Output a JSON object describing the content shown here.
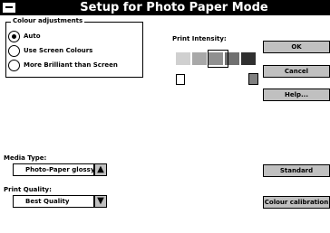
{
  "window": {
    "title": "Setup for Photo Paper Mode"
  },
  "colour_adjustments": {
    "label": "Colour adjustments",
    "options": [
      {
        "label": "Auto",
        "selected": true
      },
      {
        "label": "Use Screen Colours",
        "selected": false
      },
      {
        "label": "More Brilliant than Screen",
        "selected": false
      }
    ]
  },
  "print_intensity": {
    "label": "Print Intensity:",
    "levels": [
      "#d0d0d0",
      "#a8a8a8",
      "#909090",
      "#707070",
      "#303030"
    ],
    "selected_index": 2
  },
  "buttons": {
    "ok": "OK",
    "cancel": "Cancel",
    "help": "Help...",
    "standard": "Standard",
    "colour_calibration": "Colour calibration"
  },
  "media_type": {
    "label": "Media Type:",
    "value": "Photo-Paper glossy"
  },
  "print_quality": {
    "label": "Print Quality:",
    "value": "Best Quality"
  },
  "icons": {
    "up_arrow": "▲",
    "down_arrow": "▼"
  }
}
